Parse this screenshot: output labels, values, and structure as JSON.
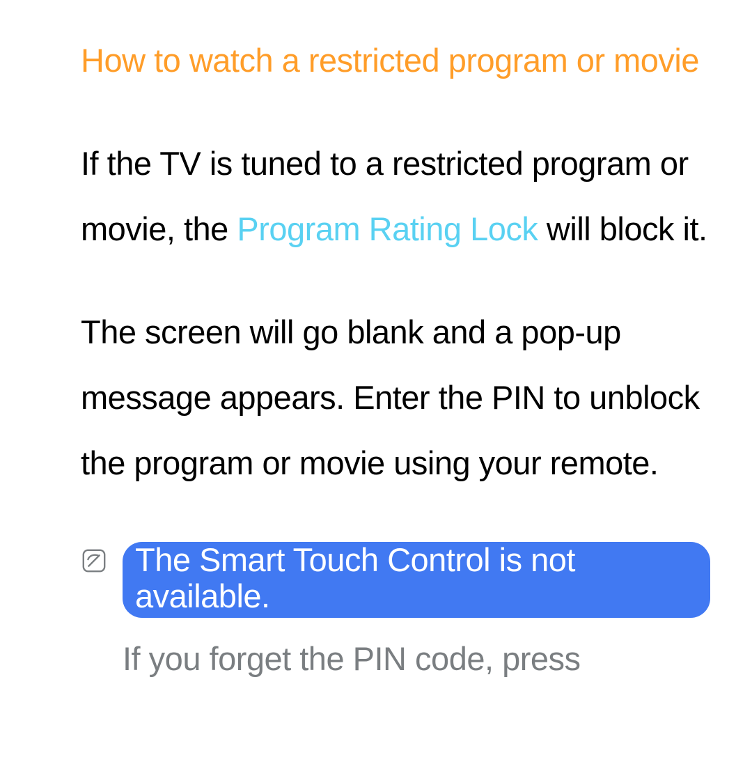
{
  "heading": "How to watch a restricted program or movie",
  "para1": {
    "pre": "If the TV is tuned to a restricted program or movie, the ",
    "link": "Program Rating Lock",
    "post": " will block it."
  },
  "para2": "The screen will go blank and a pop-up message appears. Enter the PIN to unblock the program or movie using your remote.",
  "note": {
    "badge": "The Smart Touch Control is not available.",
    "continuation": "If you forget the PIN code, press"
  }
}
